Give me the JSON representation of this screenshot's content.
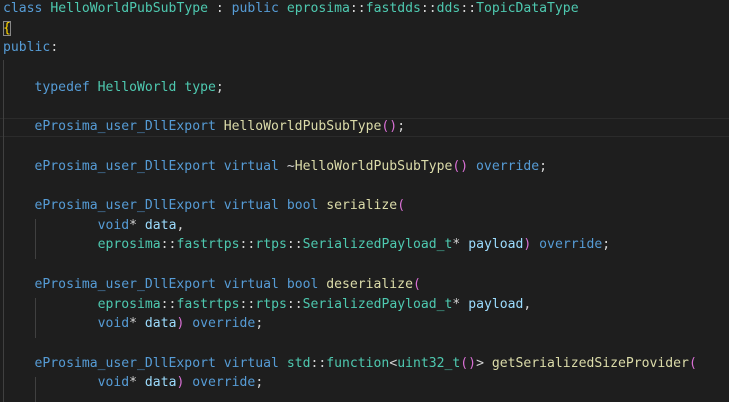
{
  "editor": {
    "language": "cpp",
    "colors": {
      "background": "#1e1e1e",
      "keyword": "#569cd6",
      "type": "#4ec9b0",
      "function": "#dcdcaa",
      "parameter": "#9cdcfe",
      "plain": "#d4d4d4",
      "bracket_level1": "#ffd700",
      "bracket_level2": "#da70d6"
    },
    "lines": [
      {
        "tokens": [
          {
            "t": "class ",
            "c": "kw"
          },
          {
            "t": "HelloWorldPubSubType",
            "c": "ty"
          },
          {
            "t": " : ",
            "c": "pl"
          },
          {
            "t": "public ",
            "c": "kw"
          },
          {
            "t": "eprosima",
            "c": "ty"
          },
          {
            "t": "::",
            "c": "pl"
          },
          {
            "t": "fastdds",
            "c": "ty"
          },
          {
            "t": "::",
            "c": "pl"
          },
          {
            "t": "dds",
            "c": "ty"
          },
          {
            "t": "::",
            "c": "pl"
          },
          {
            "t": "TopicDataType",
            "c": "ty"
          }
        ]
      },
      {
        "tokens": [
          {
            "t": "{",
            "c": "b1"
          }
        ]
      },
      {
        "tokens": [
          {
            "t": "public",
            "c": "kw"
          },
          {
            "t": ":",
            "c": "pl"
          }
        ]
      },
      {
        "tokens": []
      },
      {
        "tokens": [
          {
            "t": "    typedef ",
            "c": "kw"
          },
          {
            "t": "HelloWorld",
            "c": "ty"
          },
          {
            "t": " ",
            "c": "pl"
          },
          {
            "t": "type",
            "c": "ty"
          },
          {
            "t": ";",
            "c": "pl"
          }
        ]
      },
      {
        "tokens": []
      },
      {
        "tokens": [
          {
            "t": "    eProsima_user_DllExport ",
            "c": "kw"
          },
          {
            "t": "HelloWorldPubSubType",
            "c": "fn"
          },
          {
            "t": "()",
            "c": "b2"
          },
          {
            "t": ";",
            "c": "pl"
          }
        ]
      },
      {
        "tokens": []
      },
      {
        "tokens": [
          {
            "t": "    eProsima_user_DllExport ",
            "c": "kw"
          },
          {
            "t": "virtual ",
            "c": "kw"
          },
          {
            "t": "~",
            "c": "pl"
          },
          {
            "t": "HelloWorldPubSubType",
            "c": "fn"
          },
          {
            "t": "()",
            "c": "b2"
          },
          {
            "t": " ",
            "c": "pl"
          },
          {
            "t": "override",
            "c": "kw"
          },
          {
            "t": ";",
            "c": "pl"
          }
        ]
      },
      {
        "tokens": []
      },
      {
        "tokens": [
          {
            "t": "    eProsima_user_DllExport ",
            "c": "kw"
          },
          {
            "t": "virtual ",
            "c": "kw"
          },
          {
            "t": "bool ",
            "c": "kw"
          },
          {
            "t": "serialize",
            "c": "fn"
          },
          {
            "t": "(",
            "c": "b2"
          }
        ]
      },
      {
        "tokens": [
          {
            "t": "            void",
            "c": "kw"
          },
          {
            "t": "* ",
            "c": "pl"
          },
          {
            "t": "data",
            "c": "pa"
          },
          {
            "t": ",",
            "c": "pl"
          }
        ]
      },
      {
        "tokens": [
          {
            "t": "            eprosima",
            "c": "ty"
          },
          {
            "t": "::",
            "c": "pl"
          },
          {
            "t": "fastrtps",
            "c": "ty"
          },
          {
            "t": "::",
            "c": "pl"
          },
          {
            "t": "rtps",
            "c": "ty"
          },
          {
            "t": "::",
            "c": "pl"
          },
          {
            "t": "SerializedPayload_t",
            "c": "ty"
          },
          {
            "t": "* ",
            "c": "pl"
          },
          {
            "t": "payload",
            "c": "pa"
          },
          {
            "t": ")",
            "c": "b2"
          },
          {
            "t": " ",
            "c": "pl"
          },
          {
            "t": "override",
            "c": "kw"
          },
          {
            "t": ";",
            "c": "pl"
          }
        ]
      },
      {
        "tokens": []
      },
      {
        "tokens": [
          {
            "t": "    eProsima_user_DllExport ",
            "c": "kw"
          },
          {
            "t": "virtual ",
            "c": "kw"
          },
          {
            "t": "bool ",
            "c": "kw"
          },
          {
            "t": "deserialize",
            "c": "fn"
          },
          {
            "t": "(",
            "c": "b2"
          }
        ]
      },
      {
        "tokens": [
          {
            "t": "            eprosima",
            "c": "ty"
          },
          {
            "t": "::",
            "c": "pl"
          },
          {
            "t": "fastrtps",
            "c": "ty"
          },
          {
            "t": "::",
            "c": "pl"
          },
          {
            "t": "rtps",
            "c": "ty"
          },
          {
            "t": "::",
            "c": "pl"
          },
          {
            "t": "SerializedPayload_t",
            "c": "ty"
          },
          {
            "t": "* ",
            "c": "pl"
          },
          {
            "t": "payload",
            "c": "pa"
          },
          {
            "t": ",",
            "c": "pl"
          }
        ]
      },
      {
        "tokens": [
          {
            "t": "            void",
            "c": "kw"
          },
          {
            "t": "* ",
            "c": "pl"
          },
          {
            "t": "data",
            "c": "pa"
          },
          {
            "t": ")",
            "c": "b2"
          },
          {
            "t": " ",
            "c": "pl"
          },
          {
            "t": "override",
            "c": "kw"
          },
          {
            "t": ";",
            "c": "pl"
          }
        ]
      },
      {
        "tokens": []
      },
      {
        "tokens": [
          {
            "t": "    eProsima_user_DllExport ",
            "c": "kw"
          },
          {
            "t": "virtual ",
            "c": "kw"
          },
          {
            "t": "std",
            "c": "ty"
          },
          {
            "t": "::",
            "c": "pl"
          },
          {
            "t": "function",
            "c": "ty"
          },
          {
            "t": "<",
            "c": "pl"
          },
          {
            "t": "uint32_t",
            "c": "ty"
          },
          {
            "t": "()",
            "c": "b2"
          },
          {
            "t": "> ",
            "c": "pl"
          },
          {
            "t": "getSerializedSizeProvider",
            "c": "fn"
          },
          {
            "t": "(",
            "c": "b2"
          }
        ]
      },
      {
        "tokens": [
          {
            "t": "            void",
            "c": "kw"
          },
          {
            "t": "* ",
            "c": "pl"
          },
          {
            "t": "data",
            "c": "pa"
          },
          {
            "t": ")",
            "c": "b2"
          },
          {
            "t": " ",
            "c": "pl"
          },
          {
            "t": "override",
            "c": "kw"
          },
          {
            "t": ";",
            "c": "pl"
          }
        ]
      }
    ]
  }
}
